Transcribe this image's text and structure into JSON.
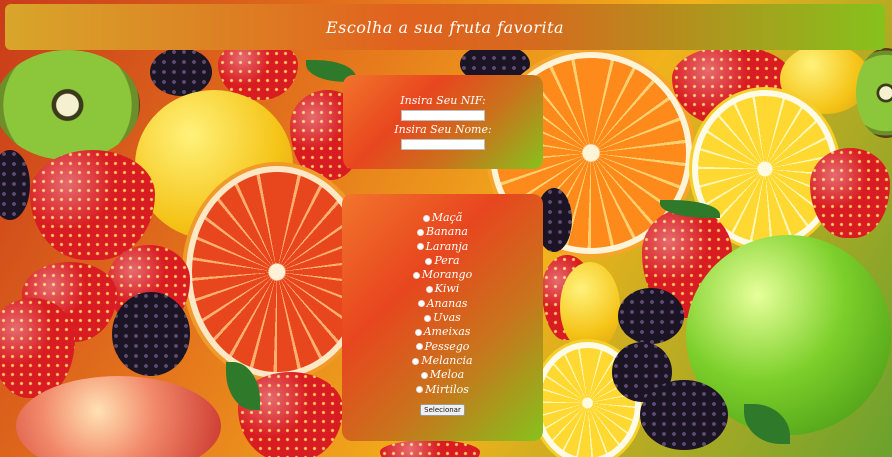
{
  "header": {
    "title": "Escolha a sua fruta favorita"
  },
  "identity_form": {
    "nif_label": "Insira Seu NIF:",
    "nif_value": "",
    "name_label": "Insira Seu Nome:",
    "name_value": ""
  },
  "fruit_form": {
    "options": [
      "Maçã",
      "Banana",
      "Laranja",
      "Pera",
      "Morango",
      "Kiwi",
      "Ananas",
      "Uvas",
      "Ameixas",
      "Pessego",
      "Melancia",
      "Meloa",
      "Mirtilos"
    ],
    "select_label": "Selecionar"
  },
  "colors": {
    "panel_gradient": [
      "#f2742c",
      "#e8461e",
      "#86c21c"
    ],
    "header_gradient": [
      "#d8a62a",
      "#e0621e",
      "#86c21c"
    ]
  },
  "background": {
    "icon": "fruit-collage-background"
  }
}
